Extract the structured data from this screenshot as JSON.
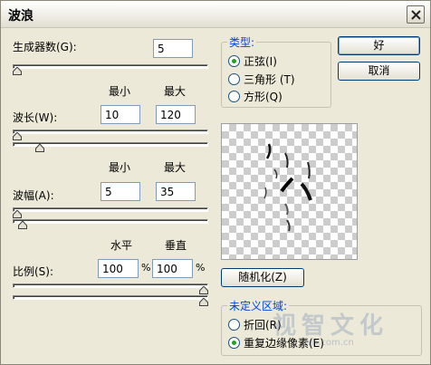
{
  "window": {
    "title": "波浪"
  },
  "generators": {
    "label": "生成器数(G):",
    "value": "5"
  },
  "wavelength": {
    "min_header": "最小",
    "max_header": "最大",
    "label": "波长(W):",
    "min_value": "10",
    "max_value": "120",
    "min_level": 0.0,
    "max_level": 0.12
  },
  "amplitude": {
    "min_header": "最小",
    "max_header": "最大",
    "label": "波幅(A):",
    "min_value": "5",
    "max_value": "35",
    "min_level": 0.0,
    "max_level": 0.03
  },
  "scale": {
    "h_header": "水平",
    "v_header": "垂直",
    "label": "比例(S):",
    "h_value": "100",
    "v_value": "100",
    "percent_symbol": "%",
    "h_level": 1.0,
    "v_level": 1.0
  },
  "type_group": {
    "title": "类型:",
    "options": [
      {
        "label": "正弦(I)",
        "checked": true
      },
      {
        "label": "三角形 (T)",
        "checked": false
      },
      {
        "label": "方形(Q)",
        "checked": false
      }
    ]
  },
  "buttons": {
    "ok": "好",
    "cancel": "取消",
    "randomize": "随机化(Z)"
  },
  "undefined_area": {
    "title": "未定义区域:",
    "options": [
      {
        "label": "折回(R)",
        "checked": false
      },
      {
        "label": "重复边缘像素(E)",
        "checked": true
      }
    ]
  },
  "watermark": {
    "text": "视智文化",
    "url": "vh.com.cn"
  },
  "colors": {
    "accent": "#0046d5",
    "radio_check": "#21a121",
    "window_bg": "#ece9d8"
  }
}
